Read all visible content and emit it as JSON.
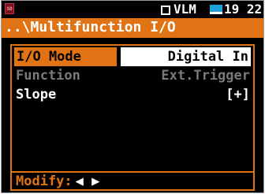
{
  "status": {
    "mode_label": "VLM",
    "clock": "19 22"
  },
  "title": "..\\Multifunction I/O",
  "rows": [
    {
      "label": "I/O Mode",
      "value": "Digital In"
    },
    {
      "label": "Function",
      "value": "Ext.Trigger"
    },
    {
      "label": "Slope",
      "value": "[+]"
    }
  ],
  "footer": {
    "modify_label": "Modify:",
    "arrows": "◀ ▶"
  },
  "colors": {
    "accent": "#e07414",
    "background": "#000000",
    "text": "#ffffff",
    "disabled": "#7a7a7a"
  }
}
